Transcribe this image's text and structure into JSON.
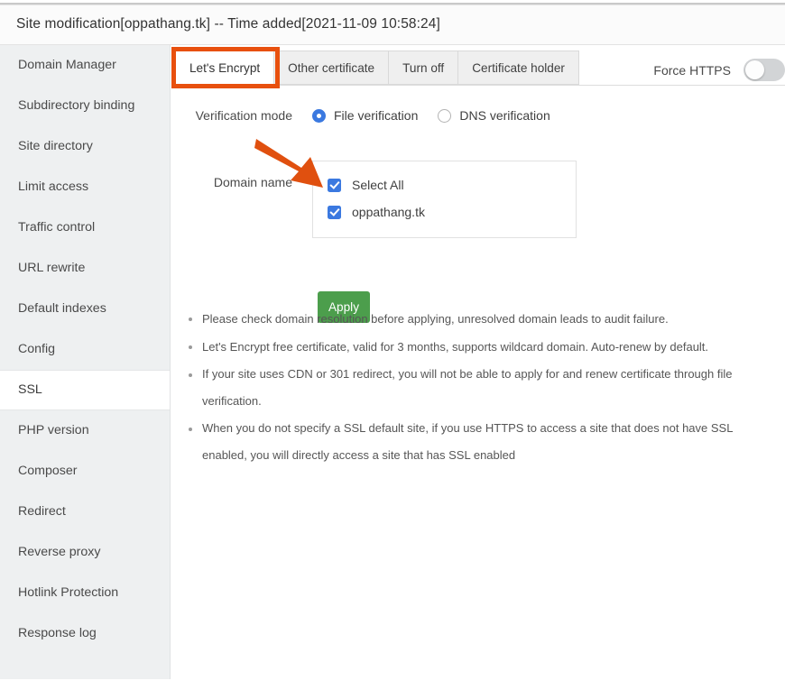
{
  "header": {
    "title": "Site modification[oppathang.tk] -- Time added[2021-11-09 10:58:24]"
  },
  "sidebar": {
    "items": [
      {
        "label": "Domain Manager",
        "active": false
      },
      {
        "label": "Subdirectory binding",
        "active": false
      },
      {
        "label": "Site directory",
        "active": false
      },
      {
        "label": "Limit access",
        "active": false
      },
      {
        "label": "Traffic control",
        "active": false
      },
      {
        "label": "URL rewrite",
        "active": false
      },
      {
        "label": "Default indexes",
        "active": false
      },
      {
        "label": "Config",
        "active": false
      },
      {
        "label": "SSL",
        "active": true
      },
      {
        "label": "PHP version",
        "active": false
      },
      {
        "label": "Composer",
        "active": false
      },
      {
        "label": "Redirect",
        "active": false
      },
      {
        "label": "Reverse proxy",
        "active": false
      },
      {
        "label": "Hotlink Protection",
        "active": false
      },
      {
        "label": "Response log",
        "active": false
      }
    ]
  },
  "tabs": [
    {
      "label": "Let's Encrypt",
      "active": true
    },
    {
      "label": "Other certificate",
      "active": false
    },
    {
      "label": "Turn off",
      "active": false
    },
    {
      "label": "Certificate holder",
      "active": false
    }
  ],
  "force_https": {
    "label": "Force HTTPS",
    "enabled": false
  },
  "verification": {
    "label": "Verification mode",
    "options": [
      {
        "label": "File verification",
        "selected": true
      },
      {
        "label": "DNS verification",
        "selected": false
      }
    ]
  },
  "domain": {
    "label": "Domain name",
    "checkboxes": [
      {
        "label": "Select All",
        "checked": true
      },
      {
        "label": "oppathang.tk",
        "checked": true
      }
    ]
  },
  "apply": {
    "label": "Apply"
  },
  "notes": [
    "Please check domain resolution before applying, unresolved domain leads to audit failure.",
    "Let's Encrypt free certificate, valid for 3 months, supports wildcard domain. Auto-renew by default.",
    "If your site uses CDN or 301 redirect, you will not be able to apply for and renew certificate through file verification.",
    "When you do not specify a SSL default site, if you use HTTPS to access a site that does not have SSL enabled, you will directly access a site that has SSL enabled"
  ],
  "annotations": {
    "highlight_color": "#e8500e",
    "arrow_color": "#e0500f",
    "highlight_target": "Let's Encrypt",
    "arrow_target": "Select All"
  },
  "colors": {
    "accent_blue": "#3b79e0",
    "apply_green": "#4c9e4c",
    "sidebar_bg": "#eef0f1",
    "annotation_orange": "#e8500e"
  }
}
